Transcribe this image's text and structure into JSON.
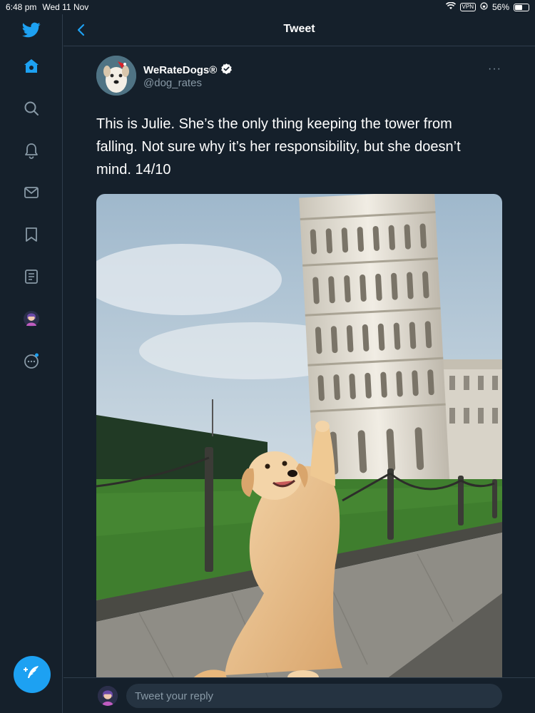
{
  "status_bar": {
    "time": "6:48 pm",
    "date": "Wed 11 Nov",
    "vpn": "VPN",
    "battery": "56%",
    "battery_level": 0.56
  },
  "sidebar": {
    "items": [
      {
        "name": "home",
        "icon": "home-icon"
      },
      {
        "name": "explore",
        "icon": "search-icon"
      },
      {
        "name": "notifications",
        "icon": "bell-icon"
      },
      {
        "name": "messages",
        "icon": "mail-icon"
      },
      {
        "name": "bookmarks",
        "icon": "bookmark-icon"
      },
      {
        "name": "lists",
        "icon": "list-icon"
      },
      {
        "name": "profile",
        "icon": "avatar-icon"
      },
      {
        "name": "more",
        "icon": "more-icon"
      }
    ],
    "compose_icon": "feather-plus-icon"
  },
  "header": {
    "title": "Tweet"
  },
  "tweet": {
    "author_name": "WeRateDogs®",
    "verified": true,
    "handle": "@dog_rates",
    "more": "···",
    "text": "This is Julie. She’s the only thing keeping the tower from falling. Not sure why it’s her responsibility, but she doesn’t mind. 14/10"
  },
  "reply": {
    "placeholder": "Tweet your reply"
  },
  "colors": {
    "background": "#15202b",
    "accent": "#1da1f2",
    "secondary_text": "#8899a6",
    "divider": "#2f3d4c"
  }
}
